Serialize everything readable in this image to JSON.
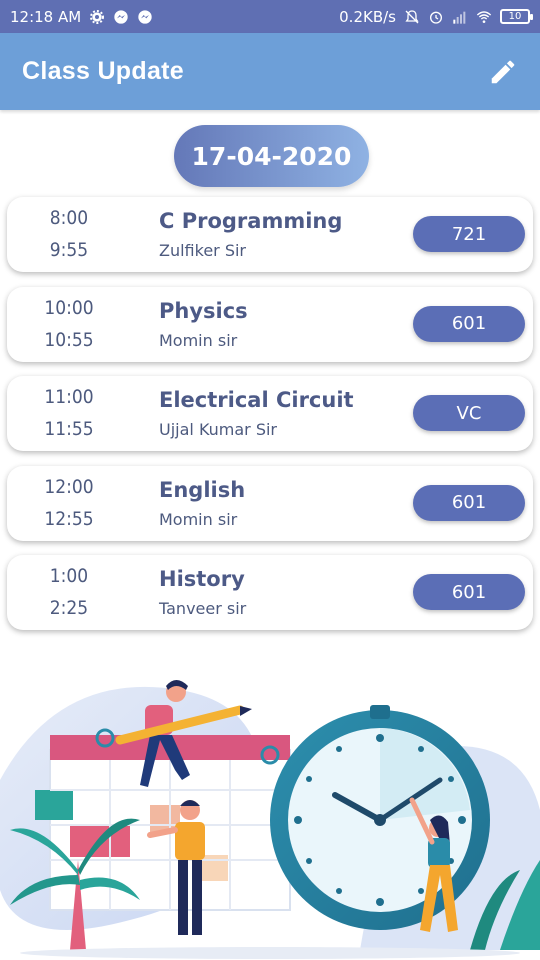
{
  "status_bar": {
    "time": "12:18 AM",
    "speed": "0.2KB/s",
    "battery": "10"
  },
  "app_bar": {
    "title": "Class Update",
    "edit_icon": "pencil-icon"
  },
  "date": "17-04-2020",
  "classes": [
    {
      "start": "8:00",
      "end": "9:55",
      "subject": "C Programming",
      "teacher": "Zulfiker Sir",
      "room": "721"
    },
    {
      "start": "10:00",
      "end": "10:55",
      "subject": "Physics",
      "teacher": "Momin sir",
      "room": "601"
    },
    {
      "start": "11:00",
      "end": "11:55",
      "subject": "Electrical Circuit",
      "teacher": "Ujjal Kumar Sir",
      "room": "VC"
    },
    {
      "start": "12:00",
      "end": "12:55",
      "subject": "English",
      "teacher": "Momin sir",
      "room": "601"
    },
    {
      "start": "1:00",
      "end": "2:25",
      "subject": "History",
      "teacher": "Tanveer sir",
      "room": "601"
    }
  ],
  "colors": {
    "status_bar": "#5f6fb3",
    "app_bar": "#6d9fd8",
    "room_badge": "#5b6eb6",
    "text_dark": "#4d5a87"
  }
}
